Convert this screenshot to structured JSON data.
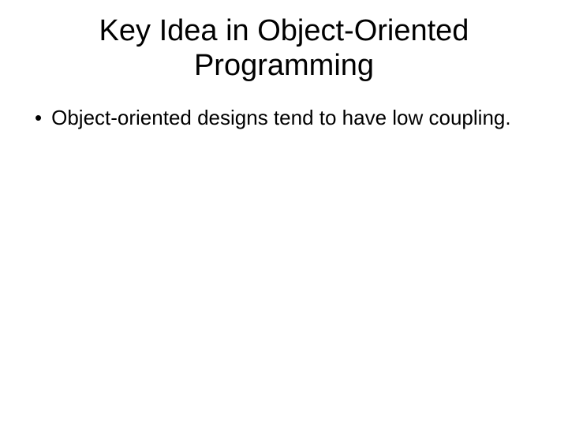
{
  "slide": {
    "title": "Key Idea in Object-Oriented Programming",
    "bullets": [
      "Object-oriented designs tend to have low coupling."
    ],
    "bullet_marker": "•"
  }
}
